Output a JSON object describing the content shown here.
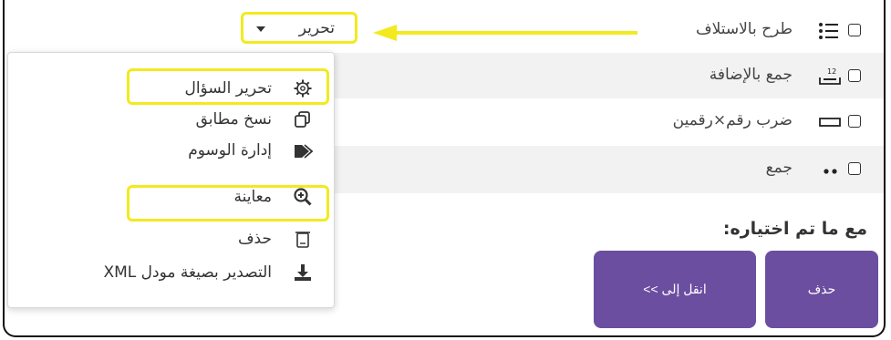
{
  "edit_button": {
    "label": "تحرير"
  },
  "questions": [
    {
      "name": "طرح بالاستلاف",
      "icon": "list-icon"
    },
    {
      "name": "جمع بالإضافة",
      "icon": "number-drop-icon"
    },
    {
      "name": "ضرب رقم×رقمين",
      "icon": "input-box-icon"
    },
    {
      "name": "جمع",
      "icon": "dots-icon"
    }
  ],
  "menu": {
    "items": [
      {
        "label": "تحرير السؤال",
        "icon": "gear-icon"
      },
      {
        "label": "نسخ مطابق",
        "icon": "copy-icon"
      },
      {
        "label": "إدارة الوسوم",
        "icon": "tag-icon"
      },
      {
        "label": "معاينة",
        "icon": "zoom-in-icon"
      },
      {
        "label": "حذف",
        "icon": "trash-icon"
      },
      {
        "label": "التصدير بصيغة مودل XML",
        "icon": "download-icon"
      }
    ]
  },
  "selection": {
    "label": "مع ما تم اختياره:",
    "move_button": "انقل إلى >>",
    "delete_button": "حذف"
  },
  "colors": {
    "highlight": "#f2ea1f",
    "button": "#6b4ea0",
    "stripe": "#f2f2f2"
  }
}
